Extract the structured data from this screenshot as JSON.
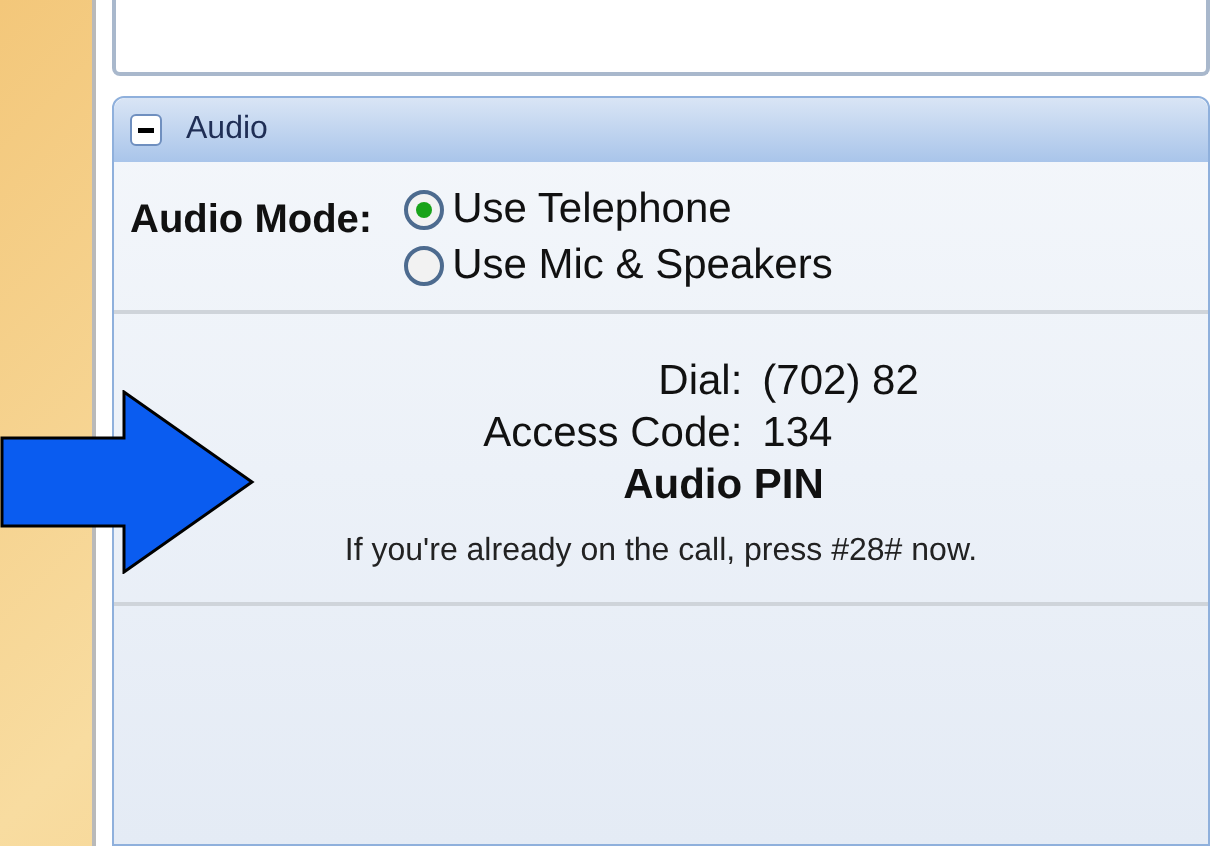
{
  "section": {
    "title": "Audio",
    "expanded": true
  },
  "audio_mode": {
    "label": "Audio Mode:",
    "options": [
      {
        "label": "Use Telephone",
        "selected": true
      },
      {
        "label": "Use Mic & Speakers",
        "selected": false
      }
    ]
  },
  "dial": {
    "label": "Dial:",
    "value": "(702) 82"
  },
  "access_code": {
    "label": "Access Code:",
    "value": "134"
  },
  "audio_pin": {
    "label": "Audio PIN"
  },
  "note": "If you're already on the call, press #28# now."
}
